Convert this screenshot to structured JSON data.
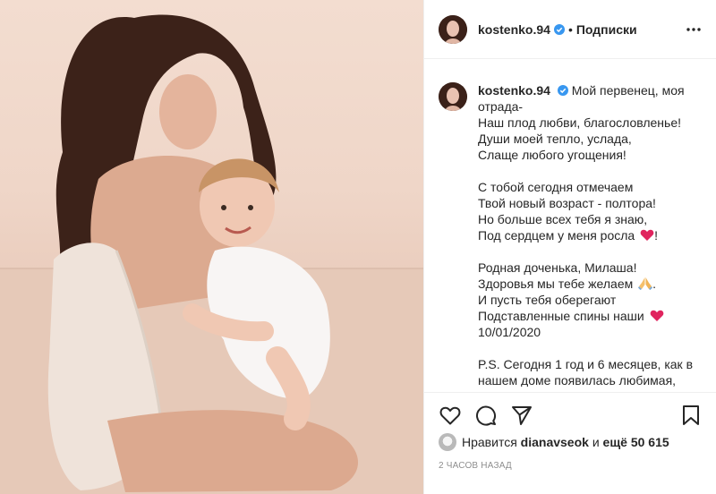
{
  "header": {
    "username": "kostenko.94",
    "separator": "•",
    "follow_label": "Подписки"
  },
  "caption": {
    "username": "kostenko.94",
    "lines": [
      "Мой первенец, моя",
      "отрада-",
      "Наш плод любви, благословленье!",
      "Души моей тепло, услада,",
      "Слаще любого угощения!",
      "",
      "С тобой сегодня отмечаем",
      "Твой новый возраст - полтора!",
      "Но больше всех тебя я знаю,",
      "Под сердцем у меня росла",
      "!",
      "Родная доченька, Милаша!",
      "Здоровья мы тебе желаем",
      ".",
      "И пусть тебя оберегают",
      "Подставленные спины наши",
      "10/01/2020",
      "P.S. Сегодня 1 год и 6 месяцев, как в",
      "нашем доме появилась любимая,"
    ]
  },
  "likes": {
    "prefix": "Нравится",
    "user": "dianavseok",
    "and": "и",
    "others": "ещё 50 615"
  },
  "timestamp": "2 часов назад",
  "icons": {
    "verified": "verified-badge-icon",
    "more": "more-options-icon",
    "like": "heart-outline-icon",
    "comment": "comment-bubble-icon",
    "share": "paper-plane-icon",
    "save": "bookmark-icon",
    "heart_emoji": "red-heart-emoji-icon",
    "pray_emoji": "folded-hands-emoji-icon"
  },
  "colors": {
    "verified": "#3897f0",
    "text": "#262626",
    "muted": "#8e8e8e",
    "heart": "#e0245e"
  }
}
